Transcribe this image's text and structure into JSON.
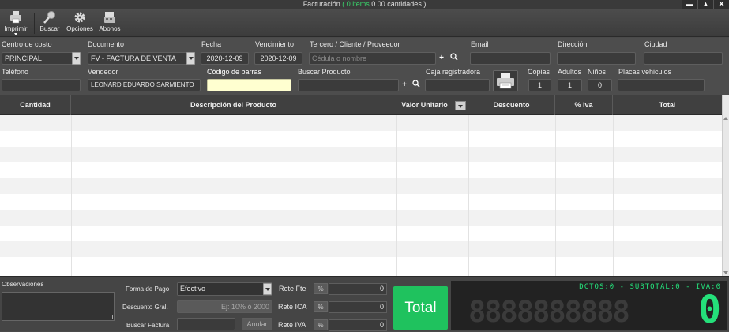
{
  "window": {
    "title_prefix": "Facturación",
    "items_text": "( 0 items",
    "qty_text": "0.00 cantidades )",
    "min": "▬",
    "max": "▲",
    "close": "✕"
  },
  "toolbar": {
    "print": "Imprimir",
    "search": "Buscar",
    "options": "Opciones",
    "payments": "Abonos"
  },
  "form": {
    "cost_center_label": "Centro de costo",
    "cost_center_value": "PRINCIPAL",
    "document_label": "Documento",
    "document_value": "FV - FACTURA DE VENTA",
    "date_label": "Fecha",
    "date_value": "2020-12-09",
    "due_label": "Vencimiento",
    "due_value": "2020-12-09",
    "third_label": "Tercero / Cliente / Proveedor",
    "third_placeholder": "Cédula o nombre",
    "email_label": "Email",
    "address_label": "Dirección",
    "city_label": "Ciudad",
    "phone_label": "Teléfono",
    "seller_label": "Vendedor",
    "seller_value": "LEONARD EDUARDO SARMIENTO",
    "barcode_label": "Código de barras",
    "product_search_label": "Buscar Producto",
    "register_label": "Caja registradora",
    "copies_label": "Copias",
    "copies_value": "1",
    "adults_label": "Adultos",
    "adults_value": "1",
    "children_label": "Niños",
    "children_value": "0",
    "plates_label": "Placas vehiculos"
  },
  "grid": {
    "columns": [
      "Cantidad",
      "Descripción del Producto",
      "Valor Unitario",
      "Descuento",
      "% Iva",
      "Total"
    ]
  },
  "bottom": {
    "observations_label": "Observaciones",
    "payment_form_label": "Forma de Pago",
    "payment_form_value": "Efectivo",
    "general_discount_label": "Descuento Gral.",
    "general_discount_placeholder": "Ej: 10% ó 2000",
    "search_invoice_label": "Buscar Factura",
    "cancel_label": "Anular",
    "rete_fte_label": "Rete Fte",
    "rete_ica_label": "Rete ICA",
    "rete_iva_label": "Rete IVA",
    "pct_symbol": "%",
    "rete_fte_value": "0",
    "rete_ica_value": "0",
    "rete_iva_value": "0",
    "total_label": "Total",
    "display_info": "DCTOS:0 - SUBTOTAL:0 - IVA:0",
    "display_ghost": "8888888888",
    "display_value": "0"
  },
  "colors": {
    "accent_green": "#1fc25e",
    "display_green": "#24e07a",
    "highlight_yellow": "#ffffd0"
  }
}
